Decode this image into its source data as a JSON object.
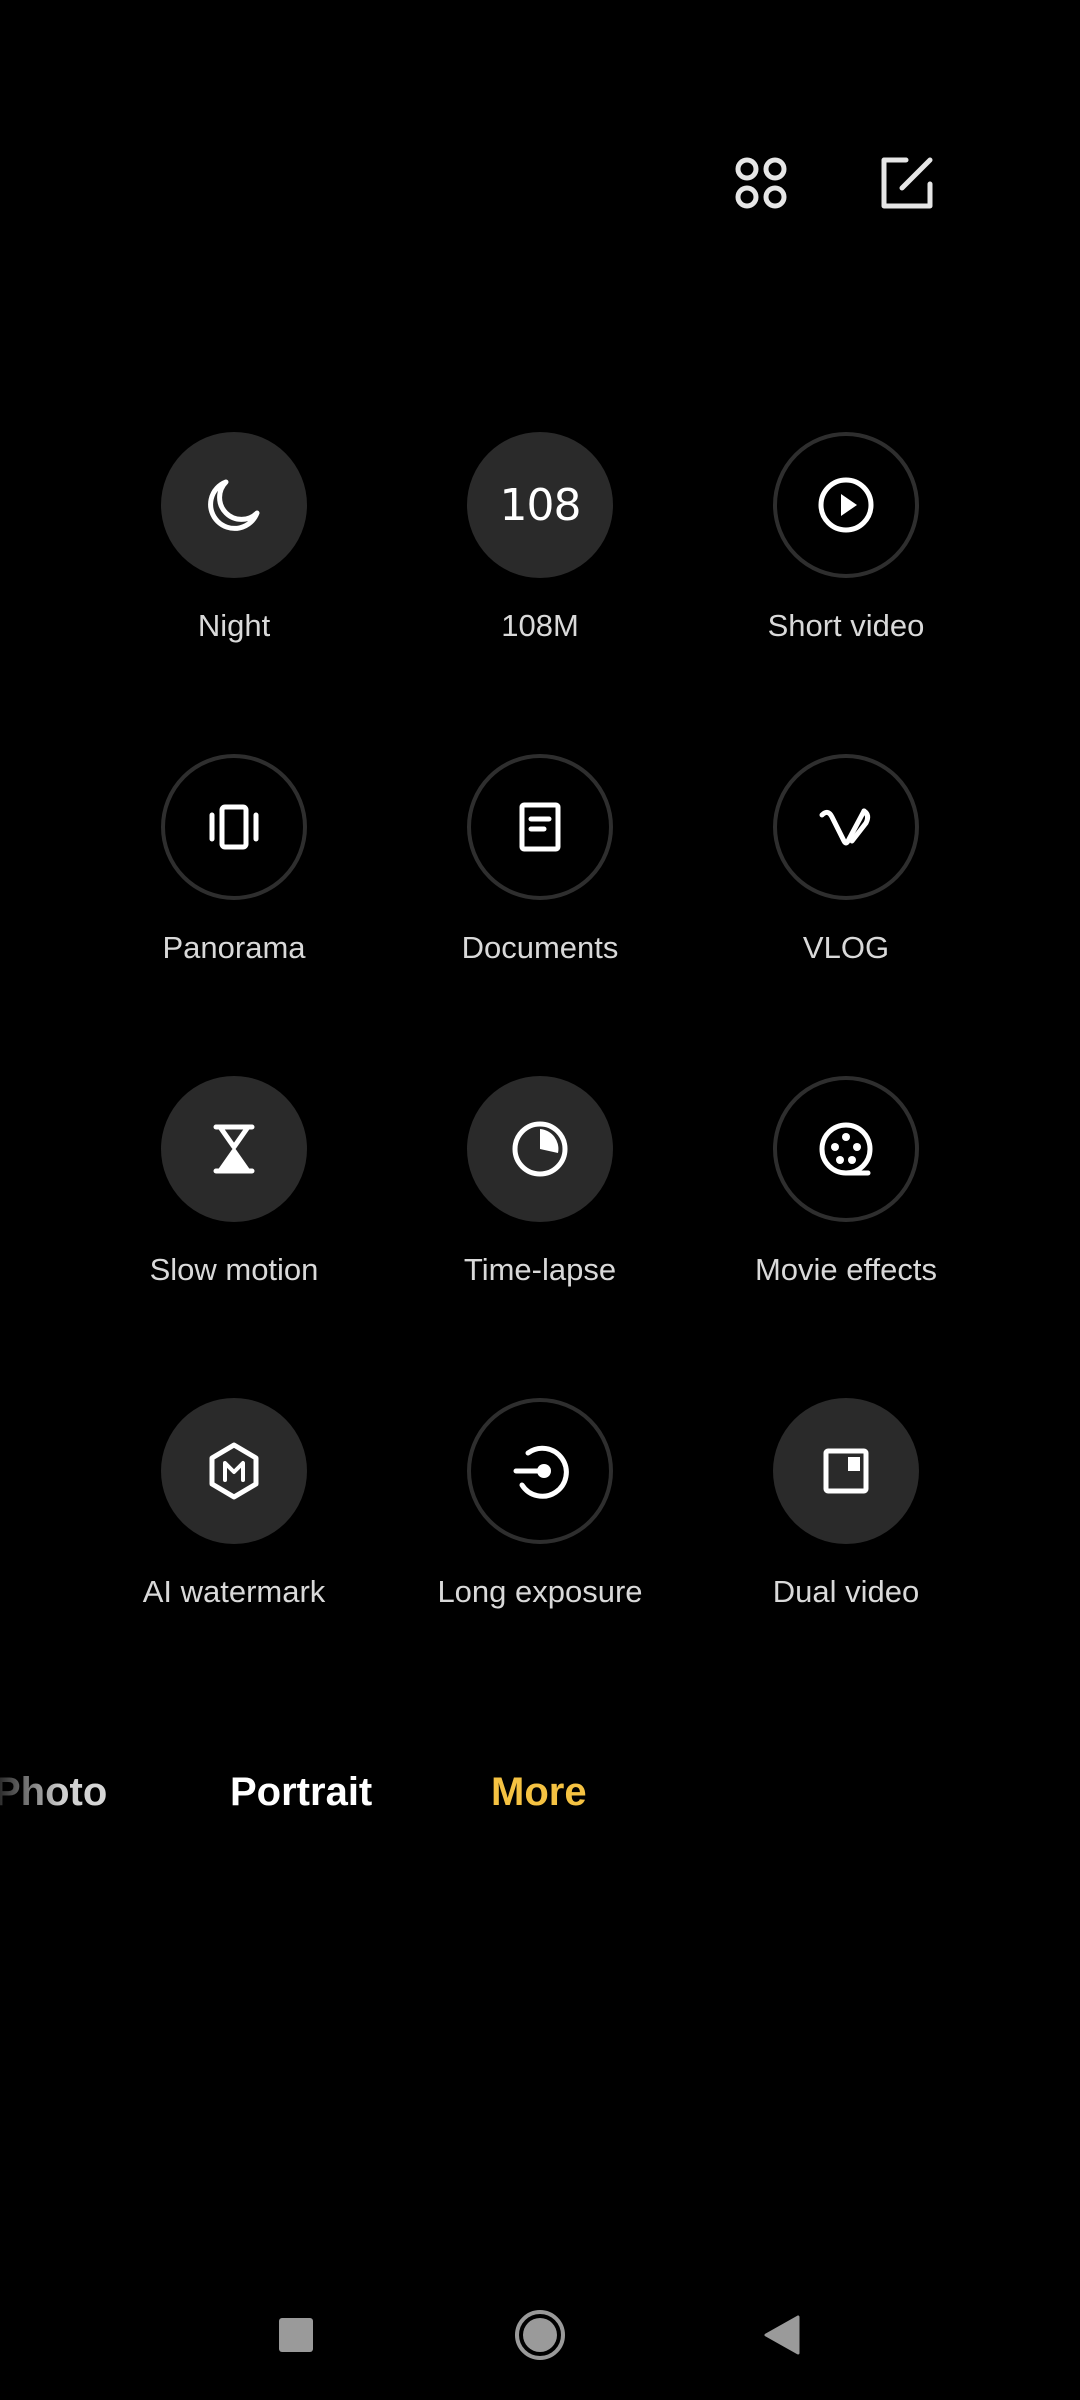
{
  "top_bar": {
    "grid_icon": "grid-four-circles-icon",
    "edit_icon": "edit-pencil-icon"
  },
  "modes": [
    {
      "label": "Night",
      "icon": "moon-icon",
      "style": "filled"
    },
    {
      "label": "108M",
      "icon": "108-icon",
      "glyph": "108",
      "style": "filled"
    },
    {
      "label": "Short video",
      "icon": "play-icon",
      "style": "outlined"
    },
    {
      "label": "Panorama",
      "icon": "panorama-icon",
      "style": "outlined"
    },
    {
      "label": "Documents",
      "icon": "document-icon",
      "style": "outlined"
    },
    {
      "label": "VLOG",
      "icon": "vlog-icon",
      "style": "outlined"
    },
    {
      "label": "Slow motion",
      "icon": "hourglass-icon",
      "style": "filled"
    },
    {
      "label": "Time-lapse",
      "icon": "timer-icon",
      "style": "filled"
    },
    {
      "label": "Movie effects",
      "icon": "film-reel-icon",
      "style": "outlined"
    },
    {
      "label": "AI watermark",
      "icon": "hexagon-m-icon",
      "style": "filled"
    },
    {
      "label": "Long exposure",
      "icon": "long-exposure-icon",
      "style": "outlined"
    },
    {
      "label": "Dual video",
      "icon": "dual-video-icon",
      "style": "filled"
    }
  ],
  "mode_tabs": {
    "photo": "Photo",
    "portrait": "Portrait",
    "more": "More"
  },
  "colors": {
    "accent": "#f5c242",
    "background": "#000000",
    "circle_fill": "#2a2a2a",
    "label": "#d9d9d9"
  },
  "nav": {
    "recents_icon": "square-recents-icon",
    "home_icon": "circle-home-icon",
    "back_icon": "triangle-back-icon"
  }
}
